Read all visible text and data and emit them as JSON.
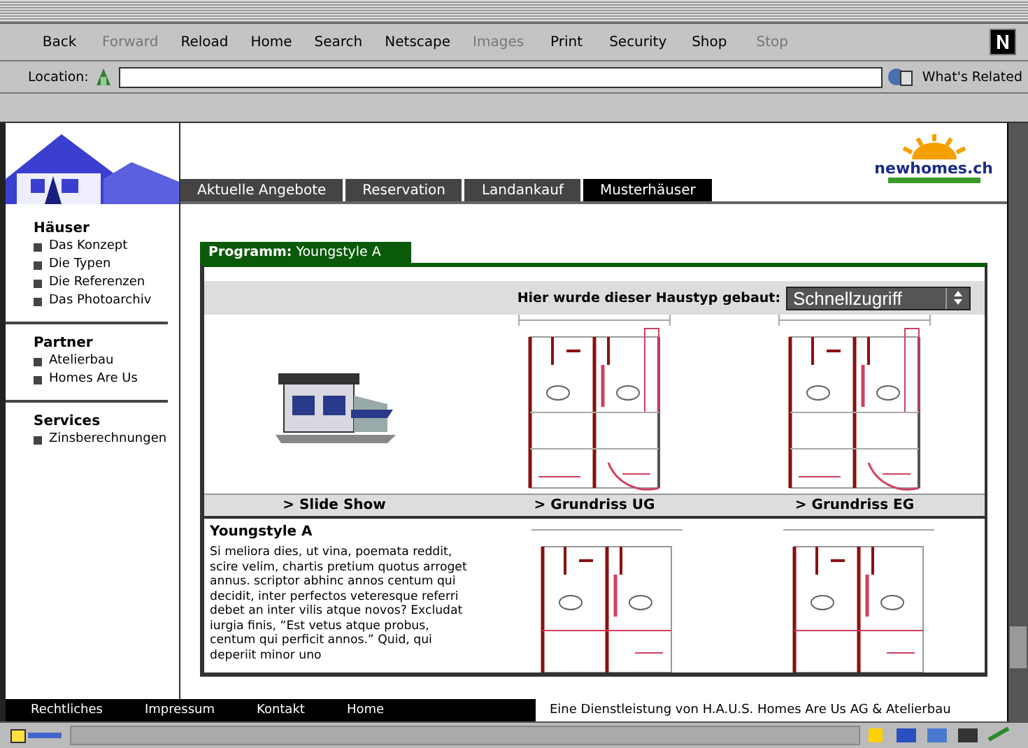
{
  "toolbar": [
    {
      "label": "Back",
      "disabled": false
    },
    {
      "label": "Forward",
      "disabled": true
    },
    {
      "label": "Reload",
      "disabled": false
    },
    {
      "label": "Home",
      "disabled": false
    },
    {
      "label": "Search",
      "disabled": false
    },
    {
      "label": "Netscape",
      "disabled": false
    },
    {
      "label": "Images",
      "disabled": true
    },
    {
      "label": "Print",
      "disabled": false
    },
    {
      "label": "Security",
      "disabled": false
    },
    {
      "label": "Shop",
      "disabled": false
    },
    {
      "label": "Stop",
      "disabled": true
    }
  ],
  "location": {
    "label": "Location:",
    "related": "What's Related"
  },
  "logo": {
    "name": "newhomes.ch"
  },
  "nav_tabs": [
    {
      "label": "Aktuelle Angebote",
      "selected": false
    },
    {
      "label": "Reservation",
      "selected": false
    },
    {
      "label": "Landankauf",
      "selected": false
    },
    {
      "label": "Musterhäuser",
      "selected": true
    }
  ],
  "sidebar": [
    {
      "heading": "Häuser",
      "items": [
        "Das Konzept",
        "Die Typen",
        "Die Referenzen",
        "Das Photoarchiv"
      ]
    },
    {
      "heading": "Partner",
      "items": [
        "Atelierbau",
        "Homes Are Us"
      ]
    },
    {
      "heading": "Services",
      "items": [
        "Zinsberechnungen"
      ]
    }
  ],
  "program": {
    "label": "Programm:",
    "name": "Youngstyle A"
  },
  "quick_access": {
    "label": "Hier wurde dieser Haustyp gebaut:",
    "value": "Schnellzugriff"
  },
  "gallery": [
    {
      "kind": "house",
      "caption": "> Slide Show"
    },
    {
      "kind": "plan",
      "caption": "> Grundriss UG"
    },
    {
      "kind": "plan",
      "caption": "> Grundriss EG"
    }
  ],
  "description": {
    "title": "Youngstyle A",
    "text": "Si meliora dies, ut vina, poemata reddit, scire velim, chartis pretium quotus arroget annus. scriptor abhinc annos centum qui decidit, inter perfectos veteresque referri debet an inter vilis atque novos? Excludat iurgia finis, “Est vetus atque probus, centum qui perficit annos.” Quid, qui deperiit minor uno"
  },
  "footer": {
    "links": [
      "Rechtliches",
      "Impressum",
      "Kontakt",
      "Home"
    ],
    "note": "Eine Dienstleistung von H.A.U.S. Homes Are Us AG & Atelierbau"
  }
}
